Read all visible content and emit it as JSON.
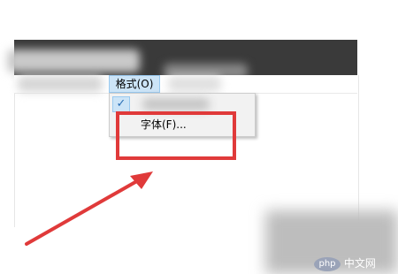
{
  "menu": {
    "format_label": "格式(O)",
    "items": [
      {
        "label": "",
        "checked": true,
        "check_glyph": "✓",
        "check_icon": "checkmark-icon"
      },
      {
        "label": "字体(F)..."
      }
    ]
  },
  "watermark": {
    "logo_text": "php",
    "text": "中文网"
  },
  "colors": {
    "highlight": "#e03a3a",
    "arrow": "#e03a3a",
    "menu_selected": "#cce4f7",
    "titlebar": "#3a3a3a"
  }
}
